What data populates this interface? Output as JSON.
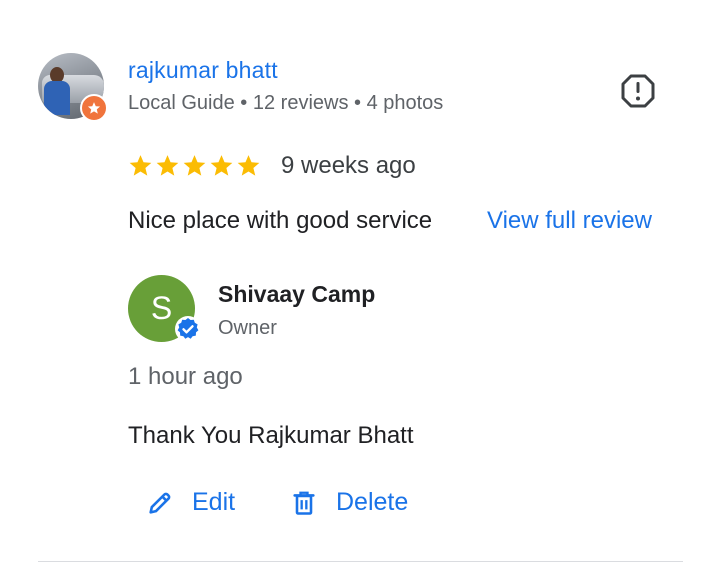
{
  "review": {
    "reviewer_name": "rajkumar bhatt",
    "reviewer_meta": "Local Guide • 12 reviews • 4 photos",
    "rating": 5,
    "time": "9 weeks ago",
    "text": "Nice place with good service",
    "view_full_label": "View full review"
  },
  "owner_reply": {
    "avatar_letter": "S",
    "name": "Shivaay Camp",
    "role": "Owner",
    "time": "1 hour ago",
    "text": "Thank You Rajkumar Bhatt",
    "edit_label": "Edit",
    "delete_label": "Delete"
  },
  "colors": {
    "link": "#1a73e8",
    "star": "#fbbc04",
    "owner_avatar": "#689f38",
    "guide_badge": "#f0743c"
  }
}
